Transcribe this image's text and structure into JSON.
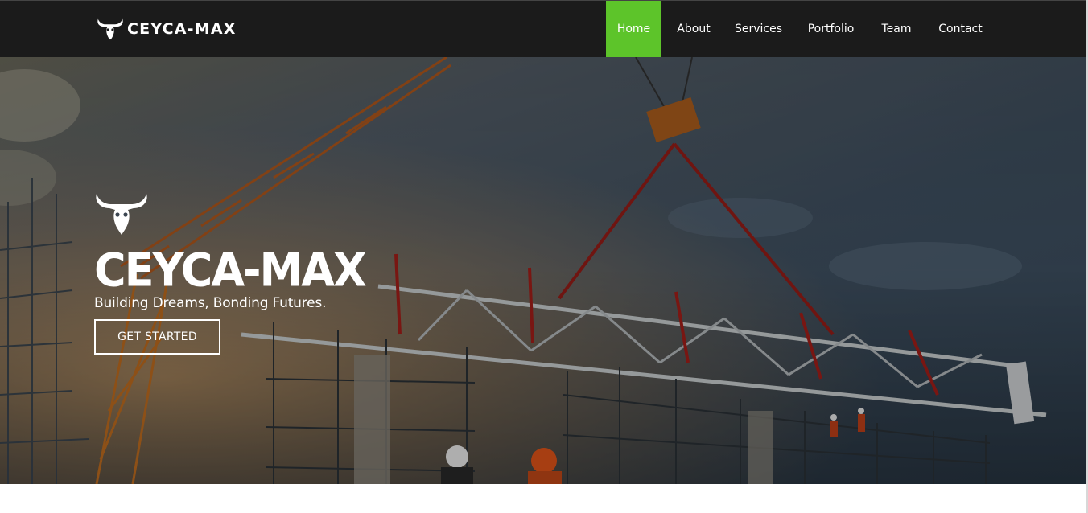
{
  "brand": {
    "name": "CEYCA-MAX",
    "logo_icon": "goat-skull-icon"
  },
  "nav": {
    "items": [
      {
        "label": "Home",
        "active": true
      },
      {
        "label": "About",
        "active": false
      },
      {
        "label": "Services",
        "active": false
      },
      {
        "label": "Portfolio",
        "active": false
      },
      {
        "label": "Team",
        "active": false
      },
      {
        "label": "Contact",
        "active": false
      }
    ]
  },
  "hero": {
    "logo_icon": "goat-skull-icon",
    "title": "CEYCA-MAX",
    "tagline": "Building Dreams, Bonding Futures.",
    "cta_label": "GET STARTED",
    "background": "construction-site-crane-photo"
  },
  "colors": {
    "navbar_bg": "#1b1b1b",
    "accent": "#5dc42a",
    "text": "#ffffff"
  }
}
